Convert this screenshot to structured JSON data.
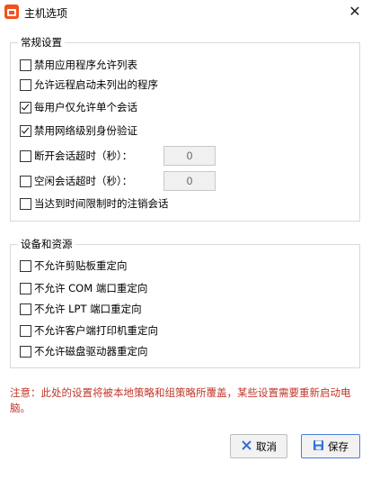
{
  "window": {
    "title": "主机选项",
    "close_glyph": "✕",
    "app_icon": "app-icon"
  },
  "general": {
    "legend": "常规设置",
    "options": [
      {
        "label": "禁用应用程序允许列表",
        "checked": false
      },
      {
        "label": "允许远程启动未列出的程序",
        "checked": false
      },
      {
        "label": "每用户仅允许单个会话",
        "checked": true
      },
      {
        "label": "禁用网络级别身份验证",
        "checked": true
      },
      {
        "label": "断开会话超时（秒）：",
        "checked": false
      },
      {
        "label": "空闲会话超时（秒）：",
        "checked": false
      },
      {
        "label": "当达到时间限制时的注销会话",
        "checked": false
      }
    ],
    "disconnect_timeout_value": "0",
    "idle_timeout_value": "0"
  },
  "devices": {
    "legend": "设备和资源",
    "options": [
      {
        "label": "不允许剪贴板重定向",
        "checked": false
      },
      {
        "label": "不允许 COM 端口重定向",
        "checked": false
      },
      {
        "label": "不允许 LPT 端口重定向",
        "checked": false
      },
      {
        "label": "不允许客户端打印机重定向",
        "checked": false
      },
      {
        "label": "不允许磁盘驱动器重定向",
        "checked": false
      }
    ]
  },
  "notice": "注意：此处的设置将被本地策略和组策略所覆盖，某些设置需要重新启动电脑。",
  "buttons": {
    "cancel_label": "取消",
    "cancel_icon": "close-icon",
    "save_label": "保存",
    "save_icon": "save-icon"
  },
  "colors": {
    "notice": "#c0392b",
    "app_icon": "#f0521e",
    "save_border": "#4a7ed8",
    "cancel_icon": "#3a6fd0"
  }
}
